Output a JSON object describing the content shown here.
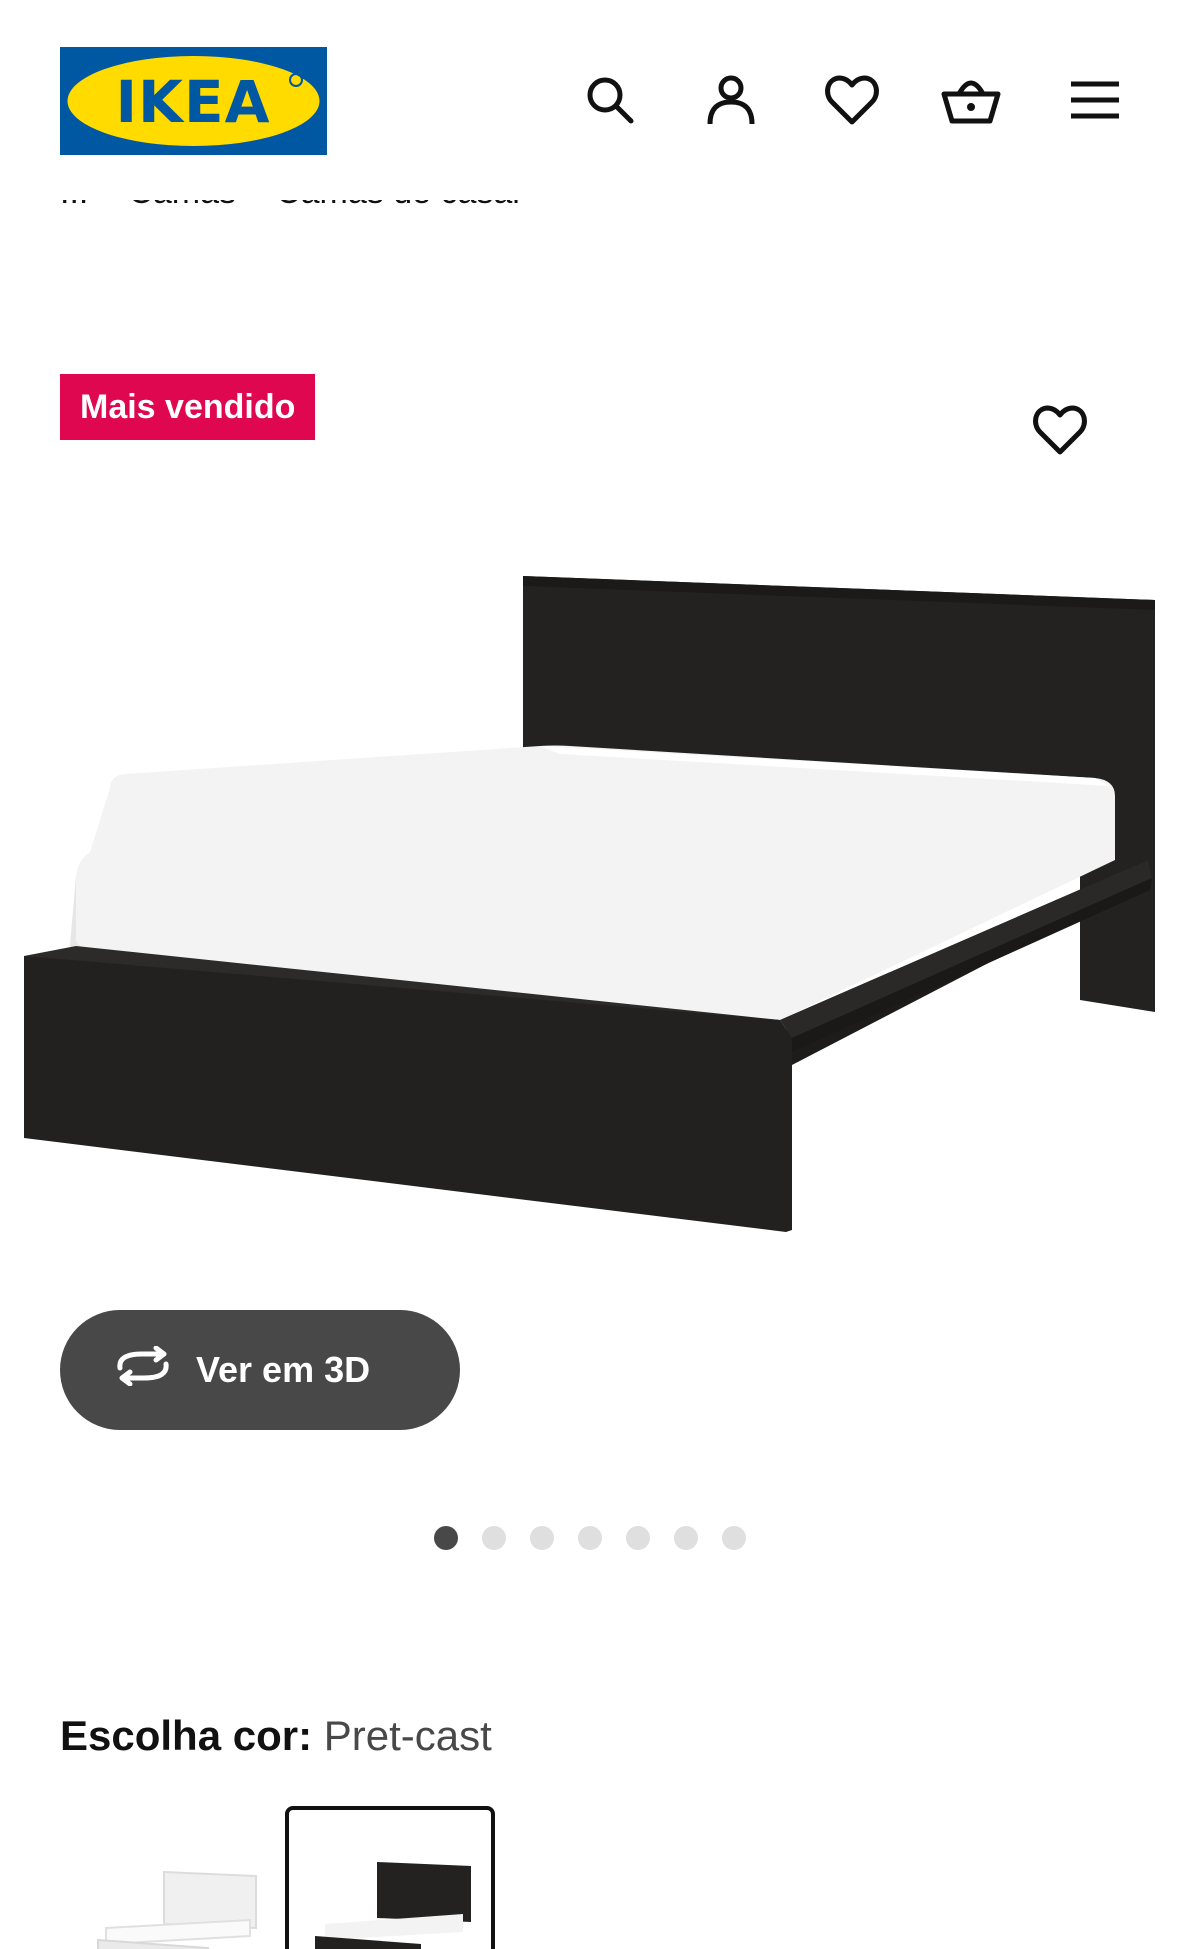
{
  "brand": {
    "logo_text": "IKEA"
  },
  "header": {
    "icons": [
      "search-icon",
      "user-icon",
      "heart-icon",
      "basket-icon",
      "menu-icon"
    ]
  },
  "breadcrumb": {
    "items": [
      "...",
      "Camas",
      "Camas de casal"
    ]
  },
  "product": {
    "badge": "Mais vendido",
    "view_3d_label": "Ver em 3D",
    "image_count": 7,
    "active_image": 1
  },
  "color_choice": {
    "label": "Escolha cor:",
    "value": "Pret-cast",
    "options": [
      "white",
      "black-brown"
    ],
    "selected": 1
  },
  "colors": {
    "ikea_blue": "#0058a3",
    "ikea_yellow": "#ffdb00",
    "badge_red": "#e00751",
    "button_dark": "#484848"
  }
}
